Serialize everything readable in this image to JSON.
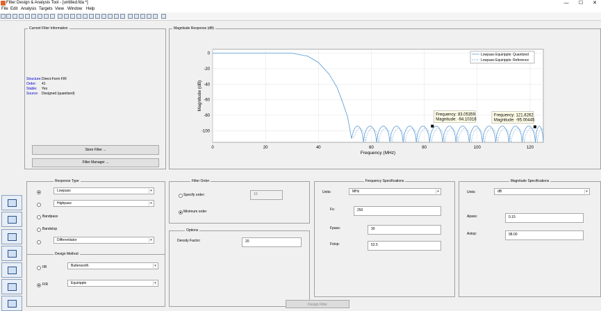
{
  "window": {
    "title": "Filter Design & Analysis Tool - [untitled.fda *]",
    "minimize": "—",
    "maximize": "☐",
    "close": "✕"
  },
  "menu": [
    "File",
    "Edit",
    "Analysis",
    "Targets",
    "View",
    "Window",
    "Help"
  ],
  "filter_info": {
    "title": "Current Filter Information",
    "rows": [
      {
        "key": "Structure:",
        "value": "Direct-Form FIR"
      },
      {
        "key": "Order:",
        "value": "41"
      },
      {
        "key": "Stable:",
        "value": "Yes"
      },
      {
        "key": "Source:",
        "value": "Designed (quantized)"
      }
    ],
    "store_button": "Store Filter ...",
    "manager_button": "Filter Manager ..."
  },
  "plot_panel": {
    "title": "Magnitude Response (dB)"
  },
  "chart_data": {
    "type": "line",
    "xlabel": "Frequency (MHz)",
    "ylabel": "Magnitude (dB)",
    "xlim": [
      0,
      125
    ],
    "ylim": [
      -115,
      5
    ],
    "xticks": [
      0,
      20,
      40,
      60,
      80,
      100,
      120
    ],
    "yticks": [
      0,
      -20,
      -40,
      -60,
      -80,
      -100
    ],
    "grid": true,
    "legend_position": "top-right",
    "series": [
      {
        "name": "Lowpass Equiripple: Quantized",
        "style": "solid",
        "color": "#5b9bd5",
        "passband": {
          "x": [
            0,
            30
          ],
          "y": 0
        },
        "transition": {
          "x": [
            0,
            30,
            36,
            40,
            44,
            47,
            49,
            51,
            52.5
          ],
          "y": [
            0,
            0,
            -4,
            -12,
            -27,
            -44,
            -62,
            -82,
            -110
          ]
        },
        "lobe_edges": [
          52.5,
          57,
          62,
          67,
          72,
          77,
          82,
          87,
          92,
          97,
          102,
          107,
          112,
          117,
          122,
          125
        ],
        "lobe_peak": -94
      },
      {
        "name": "Lowpass Equiripple: Reference",
        "style": "dashed",
        "color": "#5b9bd5"
      }
    ],
    "datatips": [
      {
        "x": 83.05359,
        "y": -94.10316,
        "text1": "Frequency: 83.05359",
        "text2": "Magnitude: -94.10316"
      },
      {
        "x": 121.8262,
        "y": -95.00445,
        "text1": "Frequency: 121.8262",
        "text2": "Magnitude: -95.00445"
      }
    ]
  },
  "response_type": {
    "title": "Response Type",
    "options": [
      {
        "label": "Lowpass",
        "selected": true,
        "dropdown": true
      },
      {
        "label": "Highpass",
        "selected": false,
        "dropdown": true
      },
      {
        "label": "Bandpass",
        "selected": false,
        "dropdown": false
      },
      {
        "label": "Bandstop",
        "selected": false,
        "dropdown": false
      },
      {
        "label": "Differentiator",
        "selected": false,
        "dropdown": true
      }
    ]
  },
  "design_method": {
    "title": "Design Method",
    "iir_label": "IIR",
    "iir_value": "Butterworth",
    "fir_label": "FIR",
    "fir_value": "Equiripple"
  },
  "filter_order": {
    "title": "Filter Order",
    "specify_label": "Specify order:",
    "specify_value": "10",
    "minimum_label": "Minimum order"
  },
  "options": {
    "title": "Options",
    "density_label": "Density Factor:",
    "density_value": "20"
  },
  "freq_specs": {
    "title": "Frequency Specifications",
    "units_label": "Units:",
    "units_value": "MHz",
    "fs_label": "Fs:",
    "fs_value": "250",
    "fpass_label": "Fpass:",
    "fpass_value": "30",
    "fstop_label": "Fstop:",
    "fstop_value": "52.5"
  },
  "mag_specs": {
    "title": "Magnitude Specifications",
    "units_label": "Units:",
    "units_value": "dB",
    "apass_label": "Apass:",
    "apass_value": "0.15",
    "astop_label": "Astop:",
    "astop_value": "98.00"
  },
  "design_button": "Design Filter"
}
